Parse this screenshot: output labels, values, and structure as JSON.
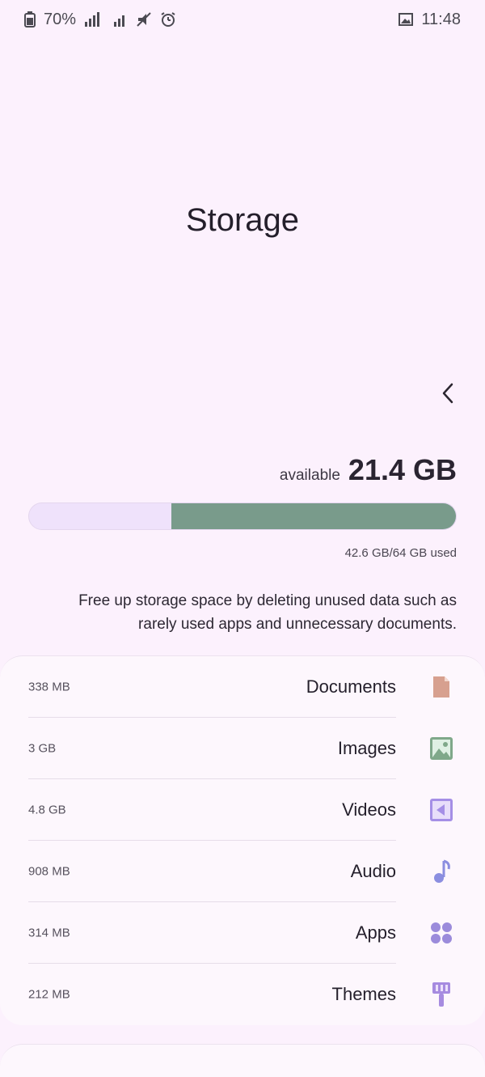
{
  "status_bar": {
    "time": "11:48",
    "battery": "70%"
  },
  "page": {
    "title": "Storage"
  },
  "summary": {
    "available_amount": "21.4 GB",
    "available_label": "available",
    "used_text": "42.6 GB/64 GB used",
    "used_fraction": 0.666
  },
  "info": {
    "text": "Free up storage space by deleting unused data such as rarely used apps and unnecessary documents."
  },
  "categories": [
    {
      "name": "Documents",
      "size": "338 MB",
      "icon": "document-icon",
      "color": "#d7a08f"
    },
    {
      "name": "Images",
      "size": "3 GB",
      "icon": "image-icon",
      "color": "#7fa88a"
    },
    {
      "name": "Videos",
      "size": "4.8 GB",
      "icon": "video-icon",
      "color": "#a58fe6"
    },
    {
      "name": "Audio",
      "size": "908 MB",
      "icon": "music-note-icon",
      "color": "#8b8ee0"
    },
    {
      "name": "Apps",
      "size": "314 MB",
      "icon": "apps-grid-icon",
      "color": "#9b8bdb"
    },
    {
      "name": "Themes",
      "size": "212 MB",
      "icon": "paint-brush-icon",
      "color": "#a68be0"
    }
  ],
  "colors": {
    "background": "#fcf1fd",
    "used_bar": "#799b8b",
    "free_bar": "#efe2fb"
  }
}
